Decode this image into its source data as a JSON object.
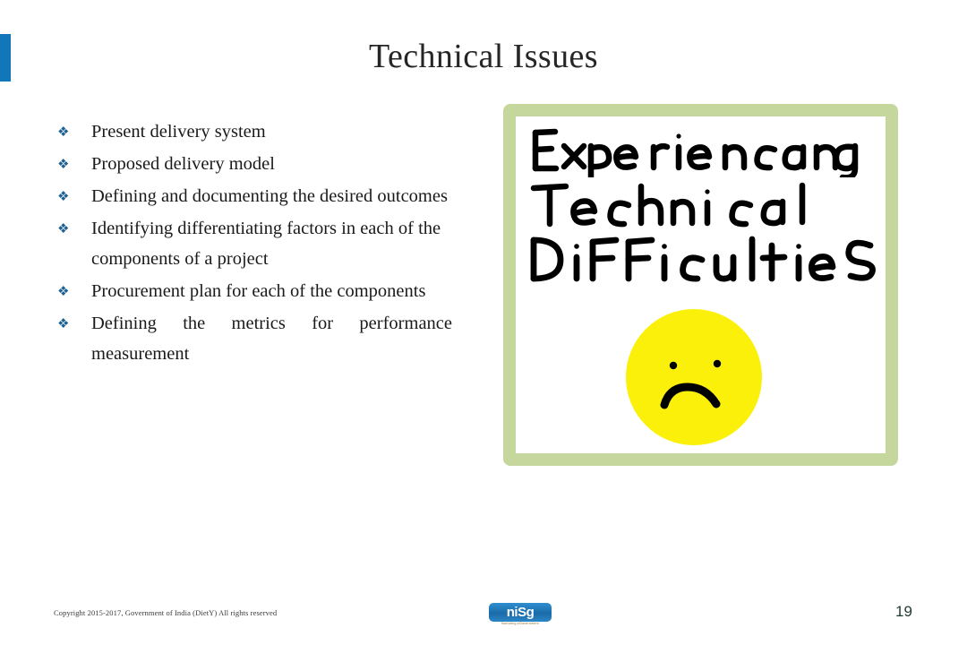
{
  "slide": {
    "title": "Technical Issues",
    "page_number": "19",
    "accent_color": "#1277b8",
    "title_color": "#262626"
  },
  "bullets": {
    "marker_glyph": "❖",
    "marker_color": "#1f6193",
    "items": [
      {
        "text": "Present delivery system",
        "justify": false
      },
      {
        "text": "Proposed delivery model",
        "justify": false
      },
      {
        "text": "Defining and documenting the desired outcomes",
        "justify": true
      },
      {
        "text": "Identifying differentiating factors in each of the components of a project",
        "justify": false
      },
      {
        "text": "Procurement plan for each of the components",
        "justify": true
      },
      {
        "text": "Defining the metrics for performance measurement",
        "justify": true
      }
    ]
  },
  "picture": {
    "frame_color": "#c5d79c",
    "background_color": "#ffffff",
    "handwritten_lines": [
      "Experiencing",
      "Technical",
      "Difficulties"
    ],
    "face": {
      "name": "sad-face",
      "fill_color": "#fbf00a",
      "feature_color": "#000000",
      "expression": "frown"
    }
  },
  "footer": {
    "copyright": "Copyright 2015-2017, Government of India (DietY) All rights reserved",
    "logo_text": "niSg",
    "logo_tagline": "Nurturing eGovernment",
    "logo_color": "#1b6ba8"
  }
}
